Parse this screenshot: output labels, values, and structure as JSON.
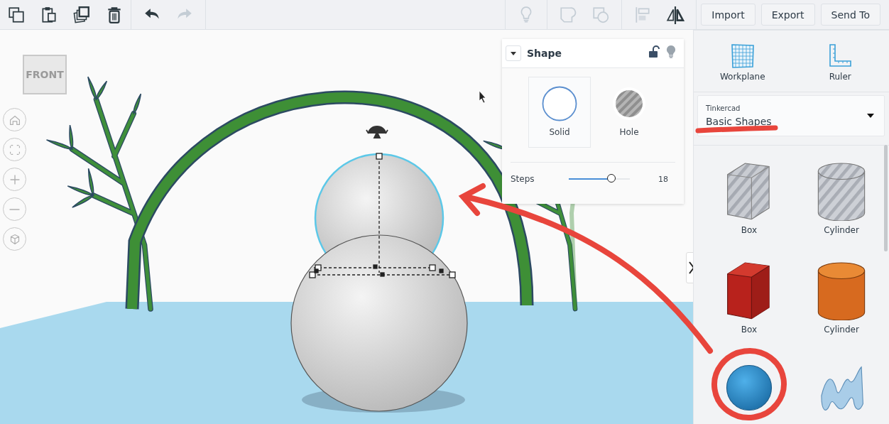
{
  "toolbar": {
    "edit_tools": [
      {
        "kind": "copy",
        "disabled": false
      },
      {
        "kind": "paste",
        "disabled": false
      },
      {
        "kind": "duplicate",
        "disabled": false
      },
      {
        "kind": "delete",
        "disabled": false
      }
    ],
    "history_tools": [
      {
        "kind": "undo",
        "disabled": false
      },
      {
        "kind": "redo",
        "disabled": true
      }
    ],
    "shape_tools": [
      {
        "kind": "note",
        "disabled": true
      },
      {
        "kind": "group",
        "disabled": true
      },
      {
        "kind": "ungroup",
        "disabled": true
      },
      {
        "kind": "align",
        "disabled": true
      },
      {
        "kind": "mirror",
        "disabled": false
      }
    ],
    "buttons": [
      "Import",
      "Export",
      "Send To"
    ]
  },
  "canvas": {
    "view_cube": {
      "label": "FRONT"
    },
    "view_controls": [
      {
        "kind": "home"
      },
      {
        "kind": "fit"
      },
      {
        "kind": "zoom-in"
      },
      {
        "kind": "zoom-out"
      },
      {
        "kind": "perspective"
      }
    ]
  },
  "shape_panel": {
    "title": "Shape",
    "locked": false,
    "options": [
      {
        "label": "Solid",
        "kind": "solid",
        "selected": true
      },
      {
        "label": "Hole",
        "kind": "hole",
        "selected": false
      }
    ],
    "steps": {
      "label": "Steps",
      "level": 0.7,
      "reading": "18"
    }
  },
  "sidebar": {
    "tools": [
      {
        "label": "Workplane",
        "kind": "workplane"
      },
      {
        "label": "Ruler",
        "kind": "ruler"
      }
    ],
    "library": {
      "source": "Tinkercad",
      "value": "Basic Shapes"
    },
    "shapes": [
      {
        "label": "Box",
        "kind": "box-hole"
      },
      {
        "label": "Cylinder",
        "kind": "cylinder-hole"
      },
      {
        "label": "Box",
        "kind": "box"
      },
      {
        "label": "Cylinder",
        "kind": "cylinder"
      },
      {
        "kind": "sphere"
      },
      {
        "kind": "scribble"
      }
    ]
  }
}
